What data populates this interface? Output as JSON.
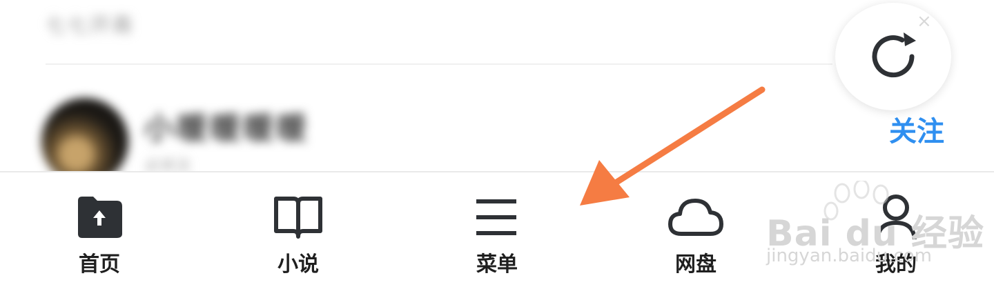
{
  "feed": {
    "top_text": "七七开斋",
    "username": "小暖暖暖暖",
    "subtext": "必关注",
    "follow_label": "关注"
  },
  "tabbar": {
    "tabs": [
      {
        "label": "首页",
        "icon": "home-upload-icon"
      },
      {
        "label": "小说",
        "icon": "book-icon"
      },
      {
        "label": "菜单",
        "icon": "menu-icon"
      },
      {
        "label": "网盘",
        "icon": "cloud-icon"
      },
      {
        "label": "我的",
        "icon": "user-icon"
      }
    ]
  },
  "watermark": {
    "brand": "Bai du 经验",
    "url": "jingyan.baidu.com"
  },
  "colors": {
    "accent": "#2f8ff0",
    "arrow": "#f57c43",
    "icon_dark": "#2e3135"
  }
}
